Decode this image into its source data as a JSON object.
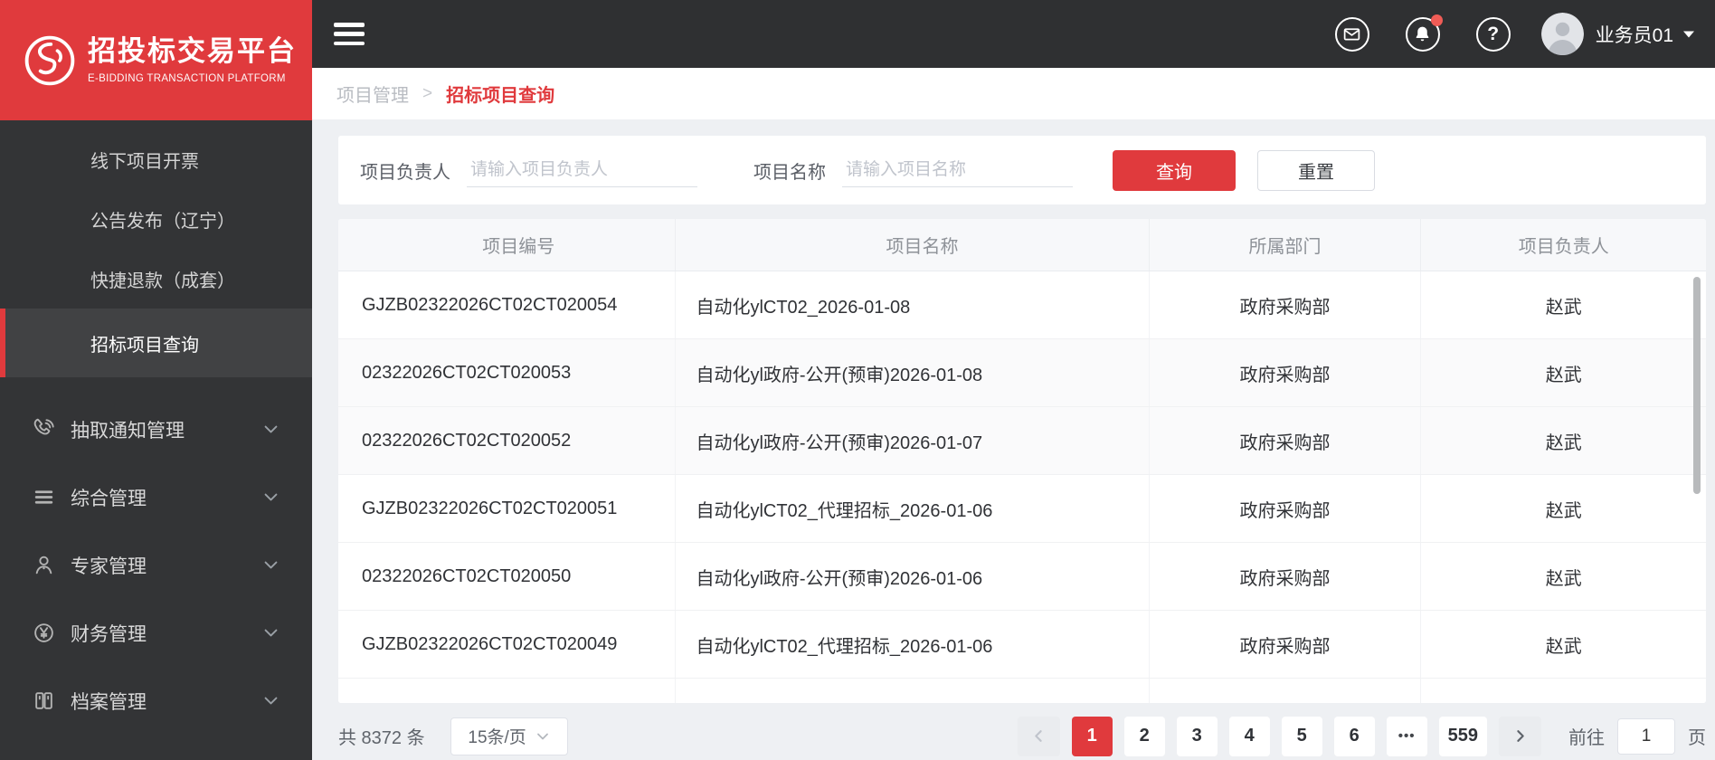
{
  "colors": {
    "accent": "#e03a3d"
  },
  "brand": {
    "title": "招投标交易平台",
    "subtitle": "E-BIDDING TRANSACTION PLATFORM"
  },
  "topbar": {
    "username": "业务员01",
    "icons": [
      "mail-icon",
      "bell-icon",
      "help-icon",
      "avatar",
      "caret-down-icon"
    ]
  },
  "breadcrumb": {
    "parent": "项目管理",
    "separator": ">",
    "current": "招标项目查询"
  },
  "sidebar": {
    "items": [
      {
        "label": "线下项目开票",
        "type": "sub",
        "active": false
      },
      {
        "label": "公告发布（辽宁）",
        "type": "sub",
        "active": false
      },
      {
        "label": "快捷退款（成套）",
        "type": "sub",
        "active": false
      },
      {
        "label": "招标项目查询",
        "type": "sub",
        "active": true
      },
      {
        "label": "抽取通知管理",
        "type": "group",
        "icon": "phone-icon"
      },
      {
        "label": "综合管理",
        "type": "group",
        "icon": "list-icon"
      },
      {
        "label": "专家管理",
        "type": "group",
        "icon": "expert-icon"
      },
      {
        "label": "财务管理",
        "type": "group",
        "icon": "finance-yuan-icon"
      },
      {
        "label": "档案管理",
        "type": "group",
        "icon": "archive-icon"
      }
    ]
  },
  "search": {
    "fields": [
      {
        "label": "项目负责人",
        "placeholder": "请输入项目负责人"
      },
      {
        "label": "项目名称",
        "placeholder": "请输入项目名称"
      }
    ],
    "query_label": "查询",
    "reset_label": "重置"
  },
  "table": {
    "columns": [
      "项目编号",
      "项目名称",
      "所属部门",
      "项目负责人"
    ],
    "rows": [
      {
        "code": "GJZB02322026CT02CT020054",
        "name": "自动化ylCT02_2026-01-08",
        "dept": "政府采购部",
        "owner": "赵武",
        "shaded": false
      },
      {
        "code": "02322026CT02CT020053",
        "name": "自动化yl政府-公开(预审)2026-01-08",
        "dept": "政府采购部",
        "owner": "赵武",
        "shaded": true
      },
      {
        "code": "02322026CT02CT020052",
        "name": "自动化yl政府-公开(预审)2026-01-07",
        "dept": "政府采购部",
        "owner": "赵武",
        "shaded": true
      },
      {
        "code": "GJZB02322026CT02CT020051",
        "name": "自动化ylCT02_代理招标_2026-01-06",
        "dept": "政府采购部",
        "owner": "赵武",
        "shaded": false
      },
      {
        "code": "02322026CT02CT020050",
        "name": "自动化yl政府-公开(预审)2026-01-06",
        "dept": "政府采购部",
        "owner": "赵武",
        "shaded": false
      },
      {
        "code": "GJZB02322026CT02CT020049",
        "name": "自动化ylCT02_代理招标_2026-01-06",
        "dept": "政府采购部",
        "owner": "赵武",
        "shaded": false
      }
    ]
  },
  "pagination": {
    "total_text": "共 8372 条",
    "page_size": "15条/页",
    "pages": [
      "1",
      "2",
      "3",
      "4",
      "5",
      "6",
      "•••",
      "559"
    ],
    "active_page": "1",
    "goto_label": "前往",
    "goto_value": "1",
    "page_unit": "页"
  }
}
